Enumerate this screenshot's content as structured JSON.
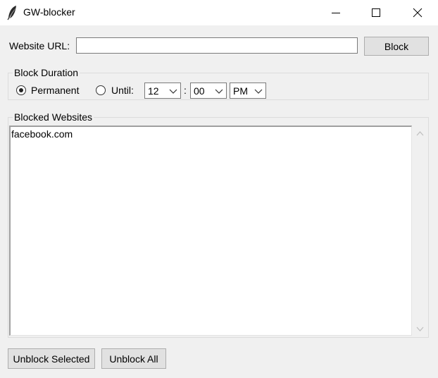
{
  "window": {
    "title": "GW-blocker",
    "controls": [
      "minimize-icon",
      "maximize-icon",
      "close-icon"
    ]
  },
  "url_row": {
    "label": "Website URL:",
    "value": "",
    "button": "Block"
  },
  "duration": {
    "title": "Block Duration",
    "permanent_label": "Permanent",
    "until_label": "Until:",
    "selected": "Permanent",
    "hour": "12",
    "separator": ":",
    "minute": "00",
    "ampm": "PM"
  },
  "blocked": {
    "title": "Blocked Websites",
    "items": [
      "facebook.com"
    ]
  },
  "actions": {
    "unblock_selected": "Unblock Selected",
    "unblock_all": "Unblock All"
  }
}
